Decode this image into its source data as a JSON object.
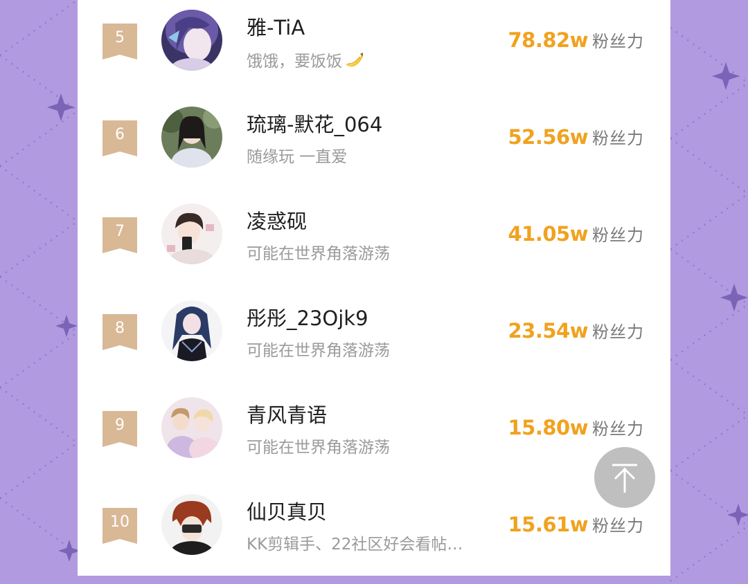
{
  "fans_label": "粉丝力",
  "rank_color": "#d9b896",
  "accent_color": "#f0a21f",
  "background_color": "#b29ae0",
  "scroll_top_icon": "arrow-up-icon",
  "entries": [
    {
      "rank": "5",
      "name": "雅-TiA",
      "signature": "饿饿，要饭饭",
      "signature_emoji": "banana-icon",
      "fans": "78.82w"
    },
    {
      "rank": "6",
      "name": "琉璃-默花_064",
      "signature": "随缘玩 一直爱",
      "fans": "52.56w"
    },
    {
      "rank": "7",
      "name": "凌惑砚",
      "signature": "可能在世界角落游荡",
      "fans": "41.05w"
    },
    {
      "rank": "8",
      "name": "彤彤_23Ojk9",
      "signature": "可能在世界角落游荡",
      "fans": "23.54w"
    },
    {
      "rank": "9",
      "name": "青风青语",
      "signature": "可能在世界角落游荡",
      "fans": "15.80w"
    },
    {
      "rank": "10",
      "name": "仙贝真贝",
      "signature": "KK剪辑手、22社区好会看帖…",
      "fans": "15.61w"
    }
  ]
}
